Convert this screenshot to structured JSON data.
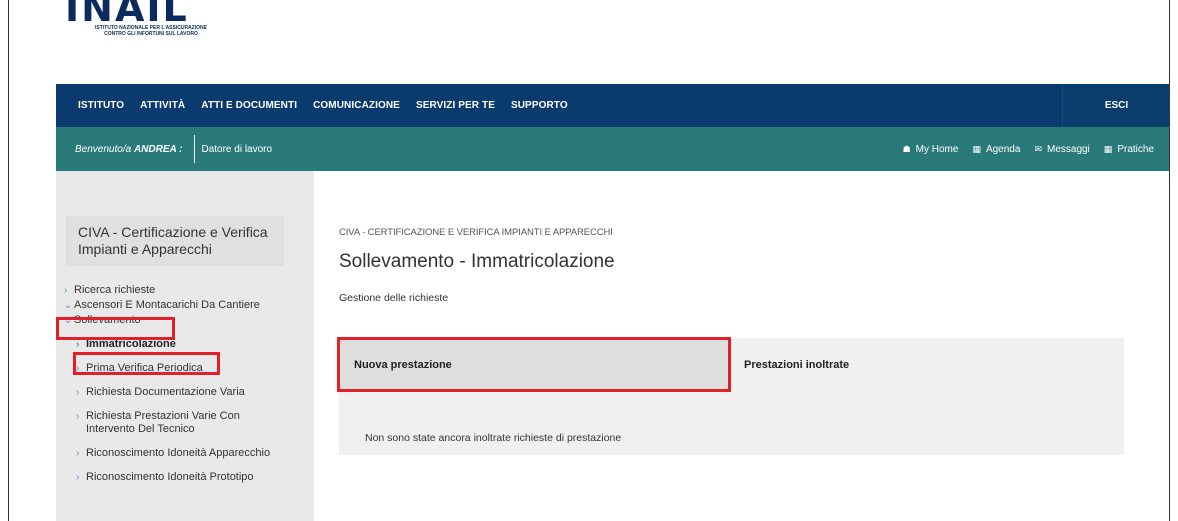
{
  "logo": {
    "word": "INAIL",
    "subtitle_line1": "ISTITUTO NAZIONALE PER L'ASSICURAZIONE",
    "subtitle_line2": "CONTRO GLI INFORTUNI SUL LAVORO"
  },
  "topnav": {
    "items": [
      "ISTITUTO",
      "ATTIVITÀ",
      "ATTI E DOCUMENTI",
      "COMUNICAZIONE",
      "SERVIZI PER TE",
      "SUPPORTO"
    ],
    "logout": "ESCI"
  },
  "userbar": {
    "welcome_prefix": "Benvenuto/a",
    "user_name": "ANDREA :",
    "role": "Datore di lavoro",
    "links": [
      {
        "icon": "home-icon",
        "label": "My Home"
      },
      {
        "icon": "calendar-icon",
        "label": "Agenda"
      },
      {
        "icon": "envelope-icon",
        "label": "Messaggi"
      },
      {
        "icon": "folder-icon",
        "label": "Pratiche"
      }
    ]
  },
  "sidebar": {
    "title": "CIVA - Certificazione e Verifica Impianti e Apparecchi",
    "items": [
      "Ricerca richieste",
      "Ascensori E Montacarichi Da Cantiere",
      "Sollevamento"
    ],
    "subitems": [
      "Immatricolazione",
      "Prima Verifica Periodica",
      "Richiesta Documentazione Varia",
      "Richiesta Prestazioni Varie Con Intervento Del Tecnico",
      "Riconoscimento Idoneità Apparecchio",
      "Riconoscimento Idoneità Prototipo"
    ]
  },
  "main": {
    "breadcrumb": "CIVA - CERTIFICAZIONE E VERIFICA IMPIANTI E APPARECCHI",
    "title": "Sollevamento - Immatricolazione",
    "subtitle": "Gestione delle richieste",
    "tabs": [
      "Nuova prestazione",
      "Prestazioni inoltrate"
    ],
    "empty_message": "Non sono state ancora inoltrate richieste di prestazione"
  },
  "colors": {
    "topnav": "#0b3a6e",
    "userbar": "#2a7a7a",
    "highlight": "#e2202a"
  }
}
